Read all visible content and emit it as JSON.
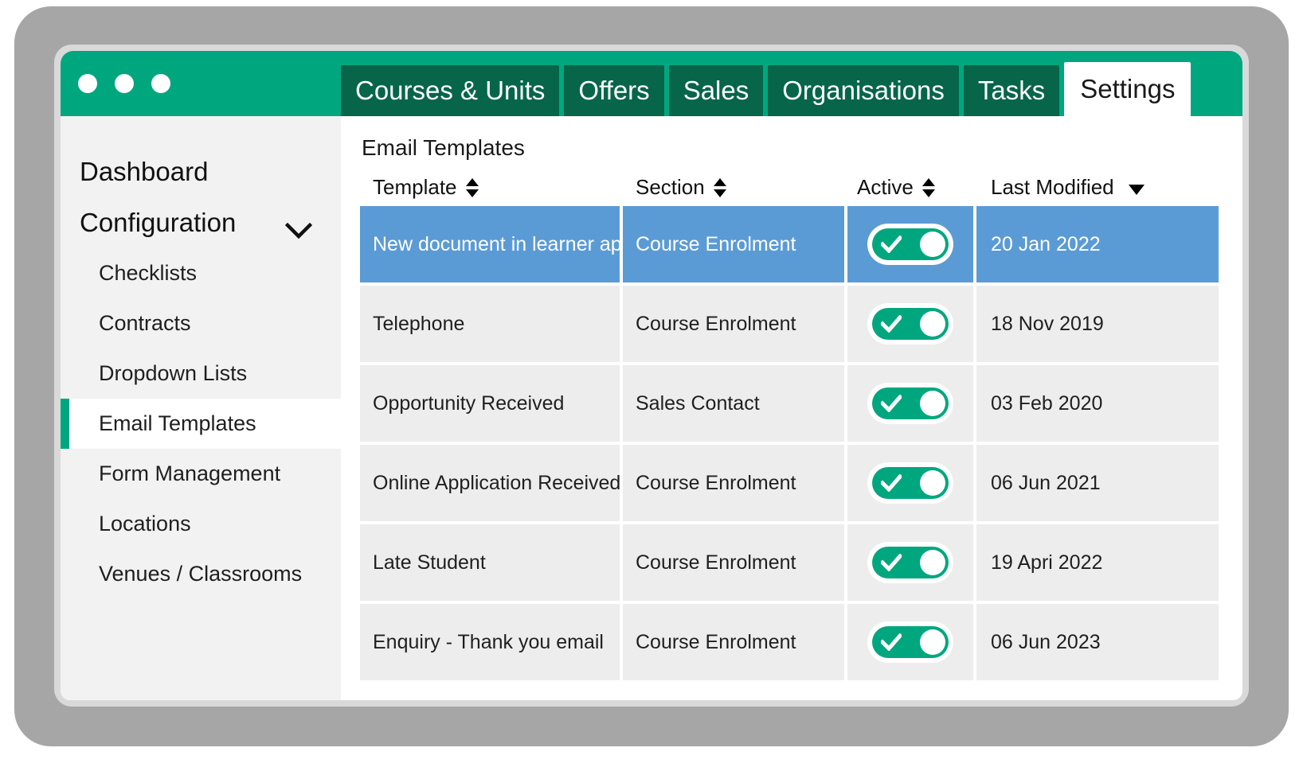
{
  "window": {
    "dots": [
      "window-dot-1",
      "window-dot-2",
      "window-dot-3"
    ],
    "tabs": [
      {
        "label": "Courses & Units",
        "active": false
      },
      {
        "label": "Offers",
        "active": false
      },
      {
        "label": "Sales",
        "active": false
      },
      {
        "label": "Organisations",
        "active": false
      },
      {
        "label": "Tasks",
        "active": false
      },
      {
        "label": "Settings",
        "active": true
      }
    ]
  },
  "sidebar": {
    "top_items": [
      {
        "label": "Dashboard",
        "has_chevron": false
      },
      {
        "label": "Configuration",
        "has_chevron": true
      }
    ],
    "items": [
      {
        "label": "Checklists",
        "selected": false
      },
      {
        "label": "Contracts",
        "selected": false
      },
      {
        "label": "Dropdown Lists",
        "selected": false
      },
      {
        "label": "Email Templates",
        "selected": true
      },
      {
        "label": "Form Management",
        "selected": false
      },
      {
        "label": "Locations",
        "selected": false
      },
      {
        "label": "Venues / Classrooms",
        "selected": false
      }
    ]
  },
  "main": {
    "panel_title": "Email Templates",
    "table": {
      "columns": [
        {
          "label": "Template",
          "sort": "both"
        },
        {
          "label": "Section",
          "sort": "both"
        },
        {
          "label": "Active",
          "sort": "both"
        },
        {
          "label": "Last Modified",
          "sort": "desc"
        }
      ],
      "rows": [
        {
          "template": "New document in learner app",
          "section": "Course Enrolment",
          "active": true,
          "last_modified": "20 Jan 2022",
          "selected": true
        },
        {
          "template": "Telephone",
          "section": "Course Enrolment",
          "active": true,
          "last_modified": "18 Nov 2019",
          "selected": false
        },
        {
          "template": "Opportunity Received",
          "section": "Sales Contact",
          "active": true,
          "last_modified": "03 Feb 2020",
          "selected": false
        },
        {
          "template": "Online Application Received",
          "section": "Course Enrolment",
          "active": true,
          "last_modified": "06 Jun 2021",
          "selected": false
        },
        {
          "template": "Late Student",
          "section": "Course Enrolment",
          "active": true,
          "last_modified": "19 Apri 2022",
          "selected": false
        },
        {
          "template": "Enquiry - Thank you email",
          "section": "Course Enrolment",
          "active": true,
          "last_modified": "06 Jun 2023",
          "selected": false
        }
      ]
    }
  },
  "colors": {
    "brand_green": "#00a77e",
    "tab_green": "#07654a",
    "selected_row_blue": "#5b9bd5",
    "row_grey": "#ededed",
    "sidebar_grey": "#f2f2f2",
    "bezel_grey": "#a6a6a6",
    "frame_grey": "#d9d9d9"
  }
}
